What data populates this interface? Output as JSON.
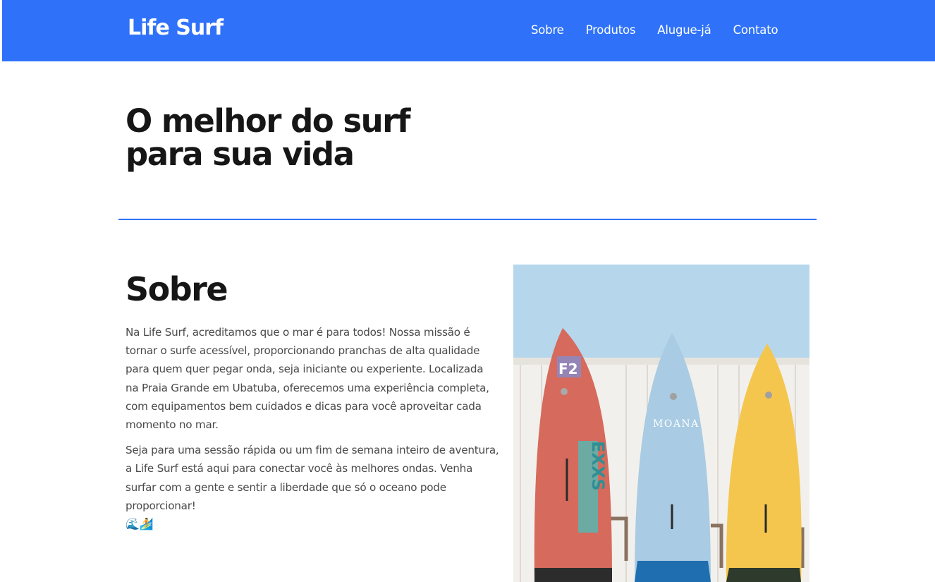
{
  "header": {
    "brand": "Life Surf",
    "nav": [
      "Sobre",
      "Produtos",
      "Alugue-já",
      "Contato"
    ]
  },
  "hero": {
    "title": "O melhor do surf para sua vida"
  },
  "about": {
    "title": "Sobre",
    "paragraph1": "Na Life Surf, acreditamos que o mar é para todos! Nossa missão é tornar o surfe acessível, proporcionando pranchas de alta qualidade para quem quer pegar onda, seja iniciante ou experiente. Localizada na Praia Grande em Ubatuba, oferecemos uma experiência completa, com equipamentos bem cuidados e dicas para você aproveitar cada momento no mar.",
    "paragraph2": "Seja para uma sessão rápida ou um fim de semana inteiro de aventura, a Life Surf está aqui para conectar você às melhores ondas. Venha surfar com a gente e sentir a liberdade que só o oceano pode proporcionar!",
    "emoji": "🌊🏄",
    "image": {
      "board_text_left": "F2",
      "board_text_middle": "MOANA",
      "board_text_vertical": "EXXS"
    }
  },
  "colors": {
    "brand_blue": "#2f72f9",
    "text_dark": "#161616",
    "text_body": "#4a4a4a"
  }
}
